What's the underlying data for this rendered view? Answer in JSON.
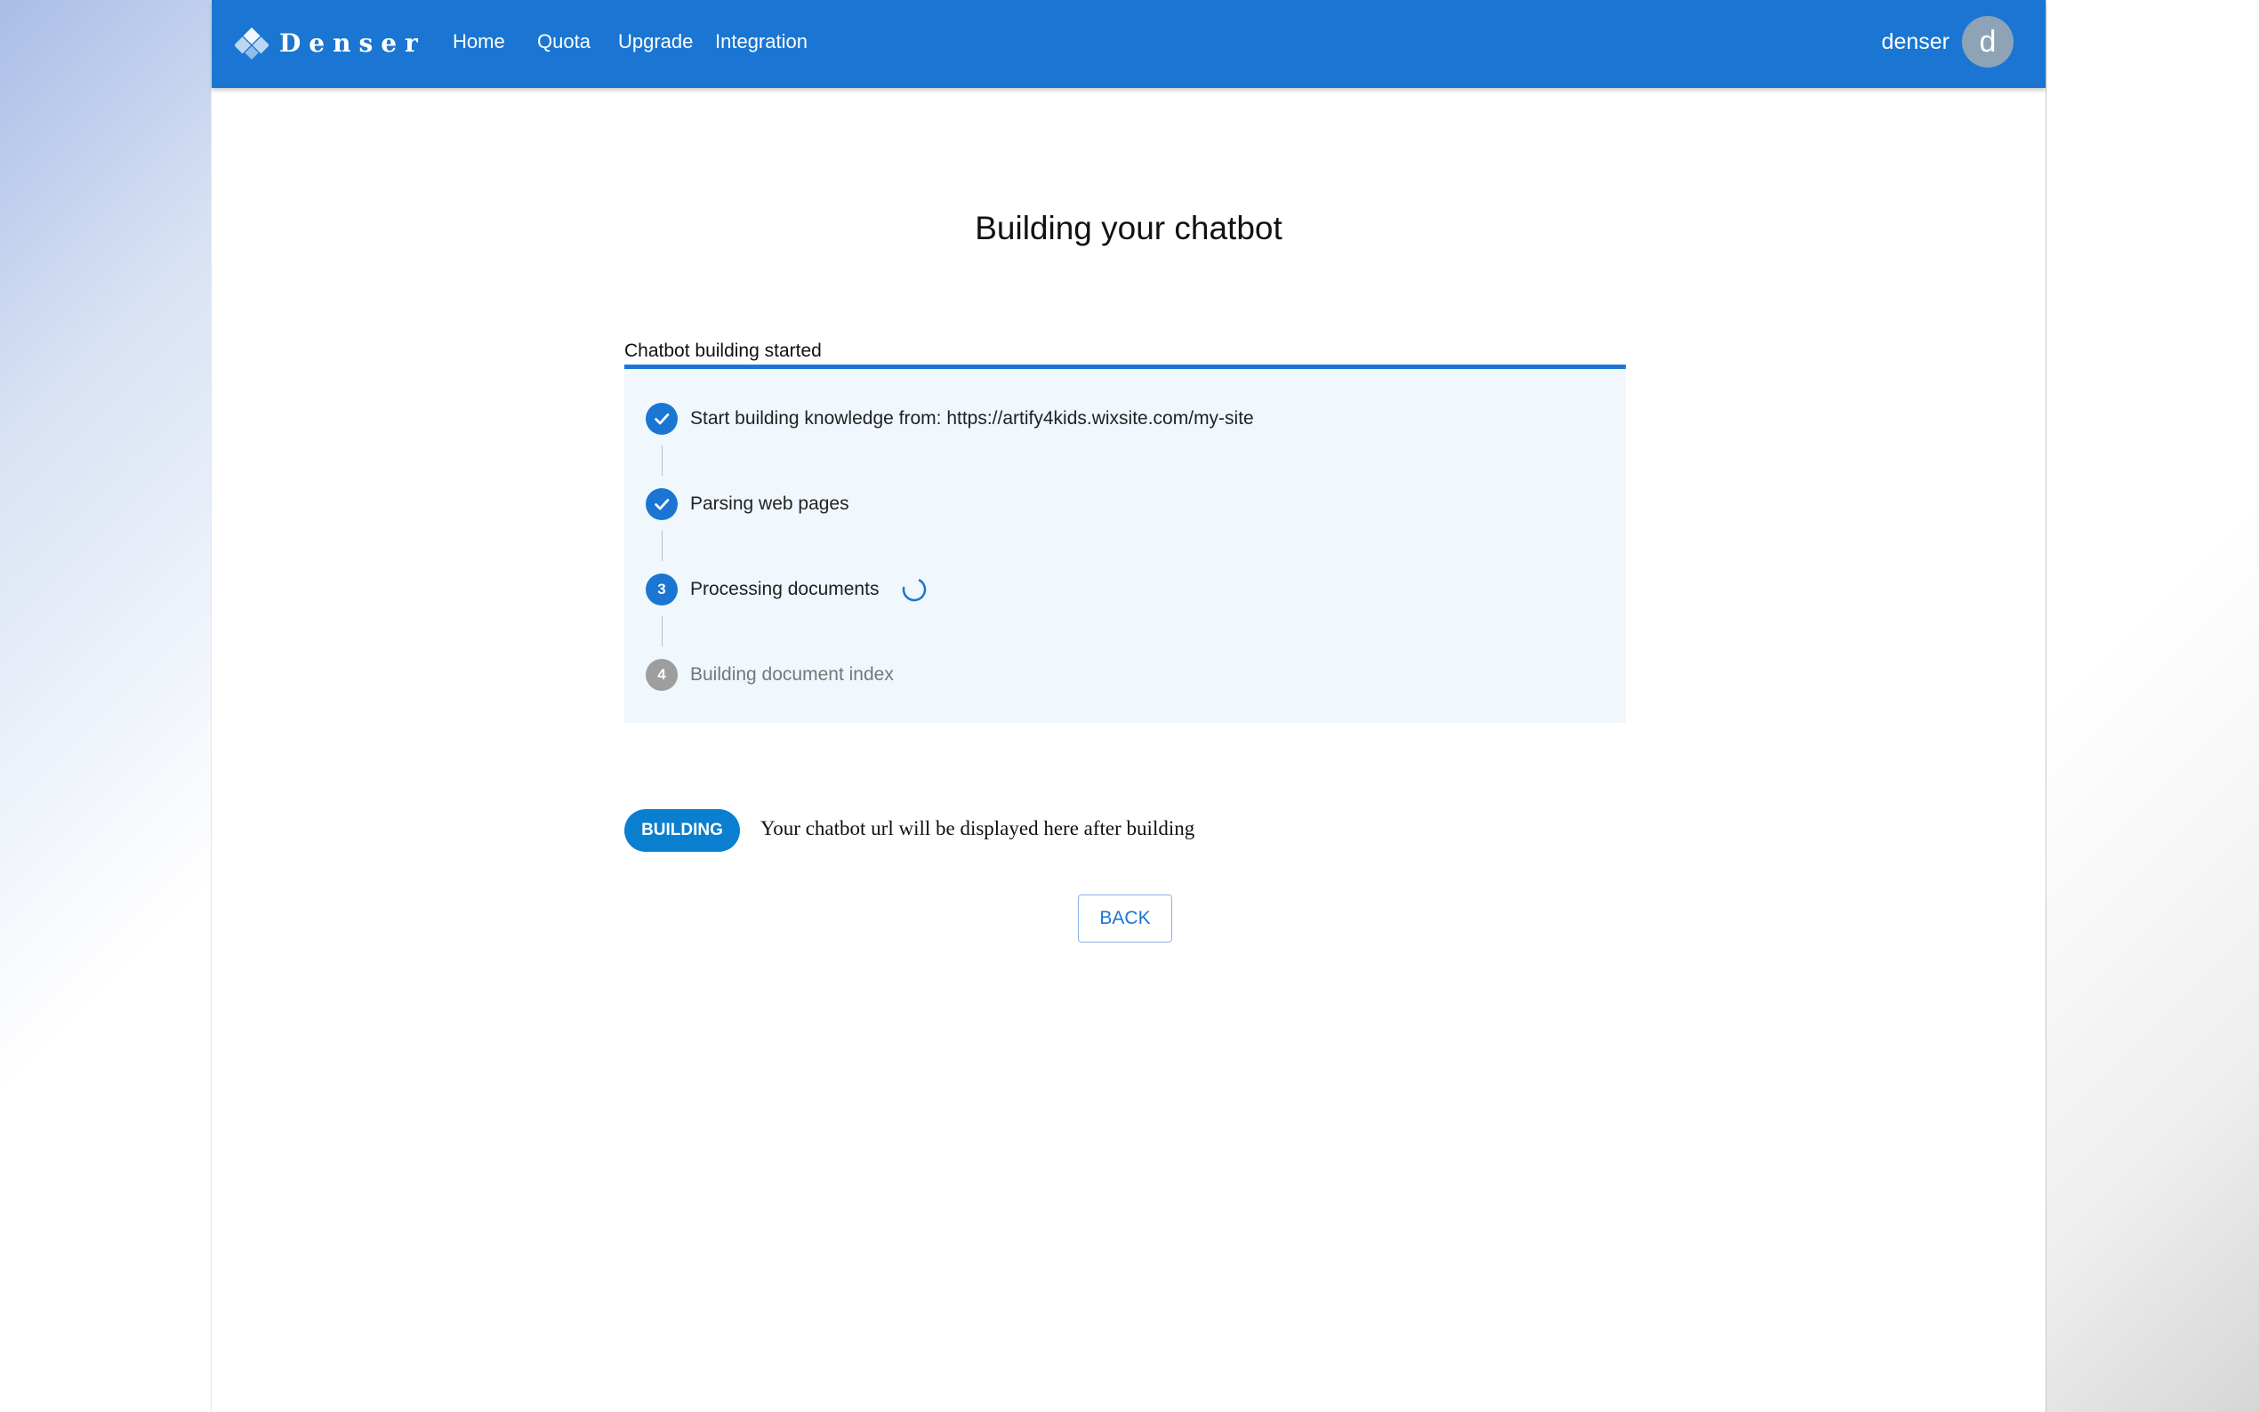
{
  "header": {
    "brand": "Denser",
    "nav": [
      {
        "label": "Home"
      },
      {
        "label": "Quota"
      },
      {
        "label": "Upgrade"
      },
      {
        "label": "Integration"
      }
    ],
    "user_name": "denser",
    "avatar_initial": "d"
  },
  "main": {
    "title": "Building your chatbot",
    "progress_label": "Chatbot building started",
    "progress_fraction": 1.0,
    "steps": [
      {
        "icon": "check-icon",
        "state": "completed",
        "label": "Start building knowledge from: https://artify4kids.wixsite.com/my-site"
      },
      {
        "icon": "check-icon",
        "state": "completed",
        "label": "Parsing web pages"
      },
      {
        "number": "3",
        "state": "active",
        "label": "Processing documents",
        "loading_icon": "spinner-icon"
      },
      {
        "number": "4",
        "state": "pending",
        "label": "Building document index"
      }
    ],
    "status_chip": "BUILDING",
    "url_message": "Your chatbot url will be displayed here after building",
    "back_button": "BACK"
  },
  "colors": {
    "primary": "#1a76d2",
    "chip": "#0a7fcf",
    "stepper_background": "#f0f7fd",
    "pending_step": "#9e9e9e",
    "avatar": "#8fa3b6"
  }
}
